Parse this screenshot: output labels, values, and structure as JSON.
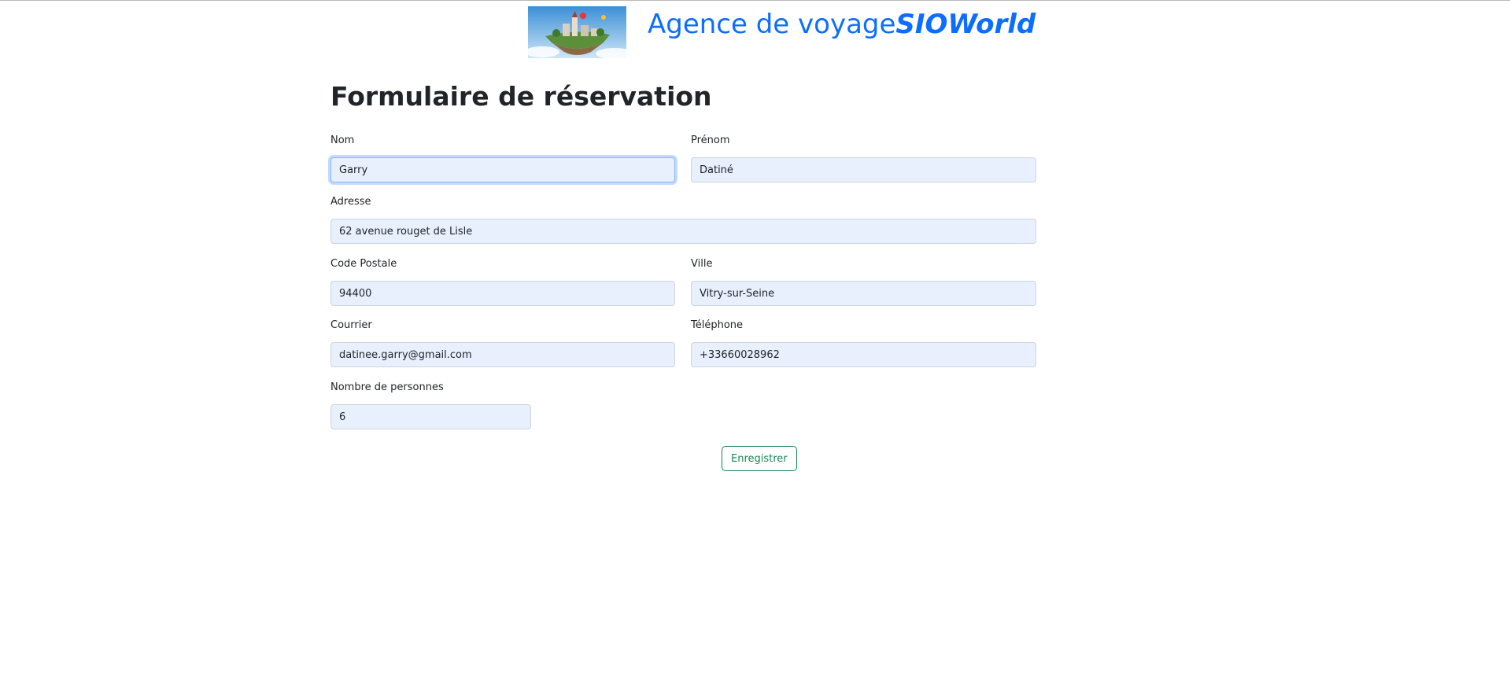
{
  "header": {
    "title_prefix": "Agence de voyage",
    "title_brand": "SIOWorld",
    "logo_icon": "floating-island-logo-icon"
  },
  "form": {
    "title": "Formulaire de réservation",
    "fields": {
      "nom": {
        "label": "Nom",
        "value": "Garry"
      },
      "prenom": {
        "label": "Prénom",
        "value": "Datiné"
      },
      "adresse": {
        "label": "Adresse",
        "value": "62 avenue rouget de Lisle"
      },
      "code_postal": {
        "label": "Code Postale",
        "value": "94400"
      },
      "ville": {
        "label": "Ville",
        "value": "Vitry-sur-Seine"
      },
      "courrier": {
        "label": "Courrier",
        "value": "datinee.garry@gmail.com"
      },
      "telephone": {
        "label": "Téléphone",
        "value": "+33660028962"
      },
      "nb_personnes": {
        "label": "Nombre de personnes",
        "value": "6"
      }
    },
    "submit_label": "Enregistrer"
  },
  "colors": {
    "accent": "#0d6efd",
    "input_bg": "#e8f0fe",
    "submit": "#198754"
  }
}
